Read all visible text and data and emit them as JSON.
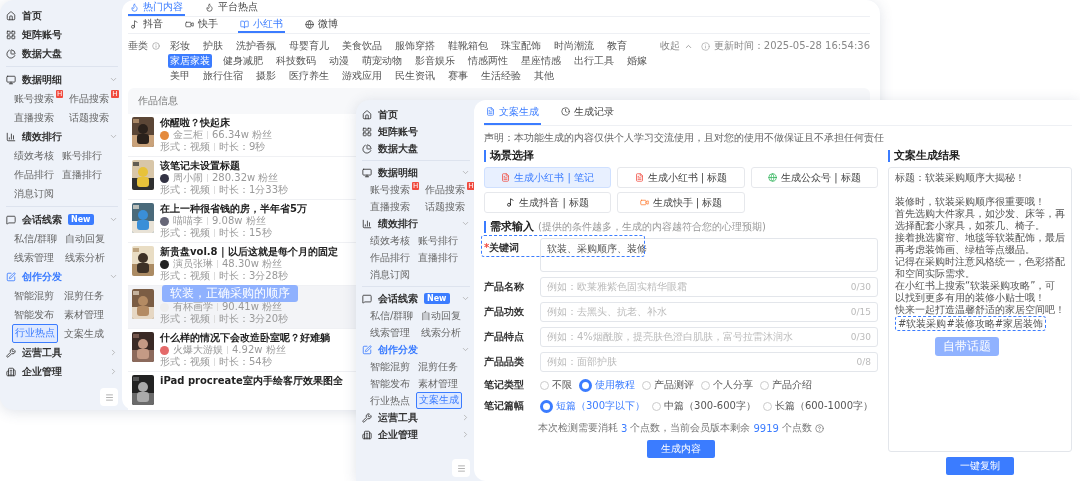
{
  "back_window": {
    "sidebar": {
      "sections": [
        {
          "items": [
            {
              "label": "首页",
              "active": false
            },
            {
              "label": "矩阵账号",
              "active": false
            },
            {
              "label": "数据大盘",
              "active": false
            }
          ]
        },
        {
          "items": [
            {
              "label": "数据明细",
              "active": false,
              "expanded": true,
              "children": [
                {
                  "label": "账号搜索",
                  "badge": "H",
                  "selected": false
                },
                {
                  "label": "作品搜索",
                  "badge": "H",
                  "selected": false
                },
                {
                  "label": "直播搜索",
                  "selected": false
                },
                {
                  "label": "话题搜索",
                  "selected": false
                }
              ]
            },
            {
              "label": "绩效排行",
              "active": false,
              "expanded": true,
              "children": [
                {
                  "label": "绩效考核",
                  "selected": false
                },
                {
                  "label": "账号排行",
                  "selected": false
                },
                {
                  "label": "作品排行",
                  "selected": false
                },
                {
                  "label": "直播排行",
                  "selected": false
                },
                {
                  "label": "消息订阅",
                  "selected": false
                }
              ]
            }
          ]
        },
        {
          "items": [
            {
              "label": "会话线索",
              "tag": "New",
              "active": false,
              "expanded": true,
              "children": [
                {
                  "label": "私信/群聊",
                  "selected": false
                },
                {
                  "label": "自动回复",
                  "selected": false
                },
                {
                  "label": "线索管理",
                  "selected": false
                },
                {
                  "label": "线索分析",
                  "selected": false
                }
              ]
            },
            {
              "label": "创作分发",
              "active": true,
              "expanded": true,
              "children": [
                {
                  "label": "智能混剪",
                  "selected": false
                },
                {
                  "label": "混剪任务",
                  "selected": false
                },
                {
                  "label": "智能发布",
                  "selected": false
                },
                {
                  "label": "素材管理",
                  "selected": false
                },
                {
                  "label": "行业热点",
                  "selected": true
                },
                {
                  "label": "文案生成",
                  "selected": false
                }
              ]
            },
            {
              "label": "运营工具",
              "active": false,
              "expanded": false
            },
            {
              "label": "企业管理",
              "active": false,
              "expanded": false
            }
          ]
        }
      ]
    },
    "content_tabs": [
      {
        "label": "热门内容",
        "selected": true
      },
      {
        "label": "平台热点",
        "selected": false
      }
    ],
    "platform_tabs": [
      {
        "label": "抖音",
        "selected": false
      },
      {
        "label": "快手",
        "selected": false
      },
      {
        "label": "小红书",
        "selected": true
      },
      {
        "label": "微博",
        "selected": false
      }
    ],
    "category_label": "垂类",
    "categories": [
      {
        "label": "彩妆",
        "selected": false
      },
      {
        "label": "护肤",
        "selected": false
      },
      {
        "label": "洗护香氛",
        "selected": false
      },
      {
        "label": "母婴育儿",
        "selected": false
      },
      {
        "label": "美食饮品",
        "selected": false
      },
      {
        "label": "服饰穿搭",
        "selected": false
      },
      {
        "label": "鞋靴箱包",
        "selected": false
      },
      {
        "label": "珠宝配饰",
        "selected": false
      },
      {
        "label": "时尚潮流",
        "selected": false
      },
      {
        "label": "教育",
        "selected": false
      },
      {
        "label": "家居家装",
        "selected": true
      },
      {
        "label": "健身减肥",
        "selected": false
      },
      {
        "label": "科技数码",
        "selected": false
      },
      {
        "label": "动漫",
        "selected": false
      },
      {
        "label": "萌宠动物",
        "selected": false
      },
      {
        "label": "影音娱乐",
        "selected": false
      },
      {
        "label": "情感两性",
        "selected": false
      },
      {
        "label": "星座情感",
        "selected": false
      },
      {
        "label": "出行工具",
        "selected": false
      },
      {
        "label": "婚嫁",
        "selected": false
      },
      {
        "label": "美甲",
        "selected": false
      },
      {
        "label": "旅行住宿",
        "selected": false
      },
      {
        "label": "摄影",
        "selected": false
      },
      {
        "label": "医疗养生",
        "selected": false
      },
      {
        "label": "游戏应用",
        "selected": false
      },
      {
        "label": "民生资讯",
        "selected": false
      },
      {
        "label": "赛事",
        "selected": false
      },
      {
        "label": "生活经验",
        "selected": false
      },
      {
        "label": "其他",
        "selected": false
      }
    ],
    "collapse_label": "收起",
    "update_time": "更新时间：2025-05-28 16:54:36",
    "list_header": "作品信息",
    "works": [
      {
        "title": "你醒啦？快起床",
        "author": "金三柜",
        "fans": "66.34w 粉丝",
        "format": "形式：视频",
        "duration": "时长：9秒"
      },
      {
        "title": "该笔记未设置标题",
        "author": "周小闹",
        "fans": "280.32w 粉丝",
        "format": "形式：视频",
        "duration": "时长：1分33秒"
      },
      {
        "title": "在上一种很省钱的房，半年省5万",
        "author": "喵喵李",
        "fans": "9.08w 粉丝",
        "format": "形式：视频",
        "duration": "时长：15秒"
      },
      {
        "title": "新贵盘vol.8 | 以后这就是每个月的固定",
        "author": "演员张琳",
        "fans": "48.30w 粉丝",
        "format": "形式：视频",
        "duration": "时长：3分28秒"
      },
      {
        "callout": "软装，正确采购的顺序",
        "author": "有杯画学",
        "fans": "90.41w 粉丝",
        "format": "形式：视频",
        "duration": "时长：3分20秒"
      },
      {
        "title": "什么样的情况下会改造卧室呢？好难躺",
        "author": "火爆大游娱",
        "fans": "4.92w 粉丝",
        "format": "形式：视频",
        "duration": "时长：54秒"
      },
      {
        "title": "iPad procreate室内手绘客厅效果图全"
      }
    ]
  },
  "front_window": {
    "sidebar": {
      "sections": [
        {
          "items": [
            {
              "label": "首页",
              "active": false
            },
            {
              "label": "矩阵账号",
              "active": false
            },
            {
              "label": "数据大盘",
              "active": false
            }
          ]
        },
        {
          "items": [
            {
              "label": "数据明细",
              "active": false,
              "expanded": true,
              "children": [
                {
                  "label": "账号搜索",
                  "badge": "H",
                  "selected": false
                },
                {
                  "label": "作品搜索",
                  "badge": "H",
                  "selected": false
                },
                {
                  "label": "直播搜索",
                  "selected": false
                },
                {
                  "label": "话题搜索",
                  "selected": false
                }
              ]
            },
            {
              "label": "绩效排行",
              "active": false,
              "expanded": true,
              "children": [
                {
                  "label": "绩效考核",
                  "selected": false
                },
                {
                  "label": "账号排行",
                  "selected": false
                },
                {
                  "label": "作品排行",
                  "selected": false
                },
                {
                  "label": "直播排行",
                  "selected": false
                },
                {
                  "label": "消息订阅",
                  "selected": false
                }
              ]
            }
          ]
        },
        {
          "items": [
            {
              "label": "会话线索",
              "tag": "New",
              "active": false,
              "expanded": true,
              "children": [
                {
                  "label": "私信/群聊",
                  "selected": false
                },
                {
                  "label": "自动回复",
                  "selected": false
                },
                {
                  "label": "线索管理",
                  "selected": false
                },
                {
                  "label": "线索分析",
                  "selected": false
                }
              ]
            },
            {
              "label": "创作分发",
              "active": true,
              "expanded": true,
              "children": [
                {
                  "label": "智能混剪",
                  "selected": false
                },
                {
                  "label": "混剪任务",
                  "selected": false
                },
                {
                  "label": "智能发布",
                  "selected": false
                },
                {
                  "label": "素材管理",
                  "selected": false
                },
                {
                  "label": "行业热点",
                  "selected": false
                },
                {
                  "label": "文案生成",
                  "selected": true
                }
              ]
            },
            {
              "label": "运营工具",
              "active": false,
              "expanded": false
            },
            {
              "label": "企业管理",
              "active": false,
              "expanded": false
            }
          ]
        }
      ]
    },
    "tabs": [
      {
        "label": "文案生成",
        "selected": true
      },
      {
        "label": "生成记录",
        "selected": false
      }
    ],
    "disclaimer": "声明：本功能生成的内容仅供个人学习交流使用，且对您的使用不做保证且不承担任何责任",
    "scene_title": "场景选择",
    "scenes": [
      {
        "label": "生成小红书 | 笔记",
        "selected": true
      },
      {
        "label": "生成小红书 | 标题",
        "selected": false
      },
      {
        "label": "生成公众号 | 标题",
        "selected": false
      },
      {
        "label": "生成抖音 | 标题",
        "selected": false
      },
      {
        "label": "生成快手 | 标题",
        "selected": false
      }
    ],
    "input_title": "需求输入",
    "input_hint": "(提供的条件越多，生成的内容越符合您的心理预期)",
    "keyword": {
      "required_mark": "*",
      "label": "关键词",
      "value": "软装、采购顺序、装修"
    },
    "fields": [
      {
        "label": "产品名称",
        "placeholder": "例如：欧莱雅紫色固实精华眼霜",
        "counter": "0/30"
      },
      {
        "label": "产品功效",
        "placeholder": "例如：去黑头、抗老、补水",
        "counter": "0/15"
      },
      {
        "label": "产品特点",
        "placeholder": "例如：4%烟酰胺，提亮肤色澄白肌肤，富号拉雷沐润水",
        "counter": "0/30"
      },
      {
        "label": "产品品类",
        "placeholder": "例如：面部护肤",
        "counter": "0/8"
      }
    ],
    "radio_groups": [
      {
        "label": "笔记类型",
        "options": [
          {
            "label": "不限",
            "selected": false
          },
          {
            "label": "使用教程",
            "selected": true
          },
          {
            "label": "产品测评",
            "selected": false
          },
          {
            "label": "个人分享",
            "selected": false
          },
          {
            "label": "产品介绍",
            "selected": false
          }
        ]
      },
      {
        "label": "笔记篇幅",
        "options": [
          {
            "label": "短篇（300字以下）",
            "selected": true
          },
          {
            "label": "中篇（300-600字）",
            "selected": false
          },
          {
            "label": "长篇（600-1000字）",
            "selected": false
          }
        ]
      }
    ],
    "cost_note": {
      "before": "本次检测需要消耗",
      "points": "3",
      "middle": "个点数，当前会员版本剩余",
      "balance": "9919",
      "after": "个点数"
    },
    "generate_button": "生成内容",
    "result": {
      "title": "文案生成结果",
      "lines": [
        "标题：软装采购顺序大揭秘！",
        "装修时，软装采购顺序很重要哦！",
        "首先选购大件家具，如沙发、床等，再选择配套小家具，如茶几、椅子。",
        "接着挑选窗帘、地毯等软装配饰，最后再考虑装饰画、绿植等点缀品。",
        "记得在采购时注意风格统一，色彩搭配和空间实际需求。",
        "在小红书上搜索“软装采购攻略”，可以找到更多有用的装修小贴士哦！",
        "快来一起打造温馨舒适的家居空间吧！"
      ],
      "hashtags": "#软装采购#装修攻略#家居装饰",
      "callout": "自带话题",
      "copy_button": "一键复制"
    }
  }
}
